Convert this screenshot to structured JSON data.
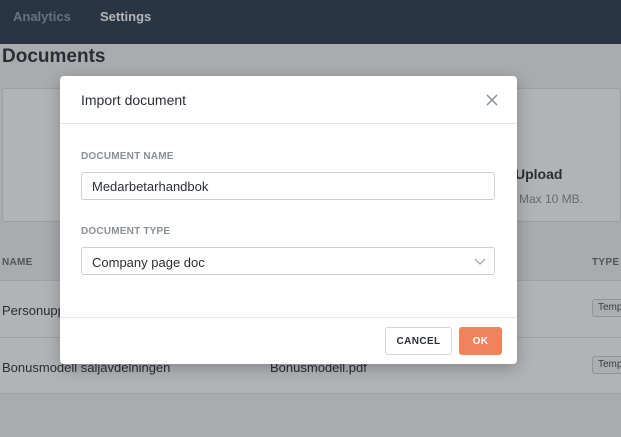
{
  "nav": {
    "analytics": "Analytics",
    "settings": "Settings"
  },
  "page": {
    "title": "Documents",
    "upload": {
      "title": "Upload",
      "subtitle": "Max 10 MB."
    },
    "table": {
      "headers": {
        "name": "NAME",
        "type": "TYPE"
      },
      "rows": [
        {
          "name": "Personuppgiftspolicy",
          "file": "",
          "type": "Template"
        },
        {
          "name": "Bonusmodell säljavdelningen",
          "file": "Bonusmodell.pdf",
          "type": "Template"
        }
      ]
    }
  },
  "modal": {
    "title": "Import document",
    "name_label": "DOCUMENT NAME",
    "name_value": "Medarbetarhandbok",
    "type_label": "DOCUMENT TYPE",
    "type_value": "Company page doc",
    "cancel_label": "CANCEL",
    "ok_label": "OK",
    "accent_color": "#f2825c"
  }
}
